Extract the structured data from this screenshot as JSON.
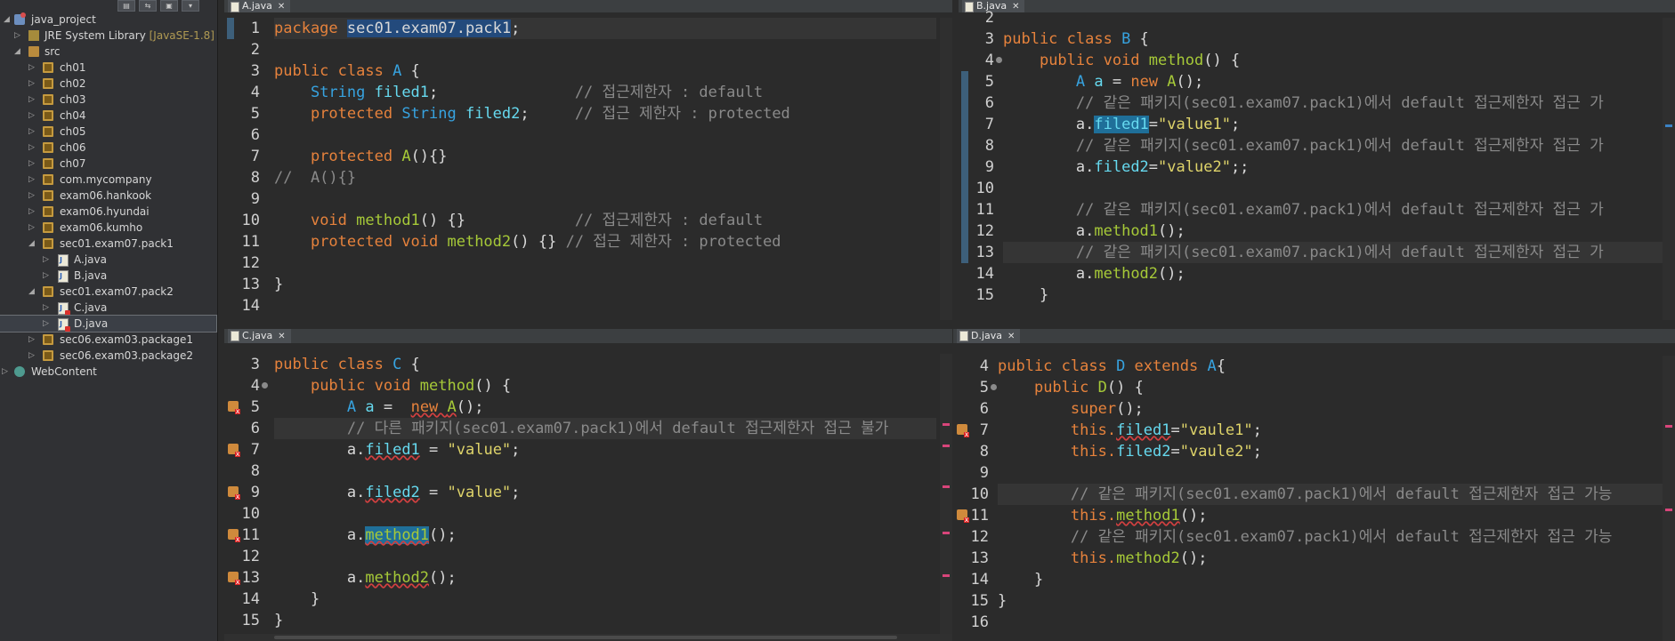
{
  "explorer": {
    "project": "java_project",
    "jre": {
      "name": "JRE System Library",
      "decorator": "[JavaSE-1.8]"
    },
    "src": "src",
    "packages": [
      "ch01",
      "ch02",
      "ch03",
      "ch04",
      "ch05",
      "ch06",
      "ch07",
      "com.mycompany",
      "exam06.hankook",
      "exam06.hyundai",
      "exam06.kumho"
    ],
    "pack1": {
      "name": "sec01.exam07.pack1",
      "files": [
        "A.java",
        "B.java"
      ]
    },
    "pack2": {
      "name": "sec01.exam07.pack2",
      "files": [
        "C.java",
        "D.java"
      ]
    },
    "more_packages": [
      "sec06.exam03.package1",
      "sec06.exam03.package2"
    ],
    "webcontent": "WebContent"
  },
  "editors": {
    "a": {
      "tab": "A.java",
      "lines": [
        "1",
        "2",
        "3",
        "4",
        "5",
        "6",
        "7",
        "8",
        "9",
        "10",
        "11",
        "12",
        "13",
        "14"
      ],
      "code": {
        "l1_kw": "package ",
        "l1_pkg": "sec01.exam07.pack1",
        "l1_end": ";",
        "l3_kw": "public class ",
        "l3_name": "A",
        "l3_end": " {",
        "l4_ty": "String ",
        "l4_f": "filed1",
        "l4_semi": ";",
        "l4_cm": "// 접근제한자 : default",
        "l5_kw": "protected ",
        "l5_ty": "String ",
        "l5_f": "filed2",
        "l5_semi": ";",
        "l5_cm": "// 접근 제한자 : protected",
        "l7_kw": "protected ",
        "l7_fn": "A",
        "l7_end": "(){}",
        "l8_cm": "//  A(){}",
        "l10_kw": "void ",
        "l10_fn": "method1",
        "l10_end": "() {}",
        "l10_cm": "// 접근제한자 : default",
        "l11_kw": "protected void ",
        "l11_fn": "method2",
        "l11_end": "() {}",
        "l11_cm": "// 접근 제한자 : protected",
        "l13": "}"
      }
    },
    "b": {
      "tab": "B.java",
      "lines": [
        "2",
        "3",
        "4",
        "5",
        "6",
        "7",
        "8",
        "9",
        "10",
        "11",
        "12",
        "13",
        "14",
        "15"
      ],
      "code": {
        "l3_kw": "public class ",
        "l3_name": "B",
        "l3_end": " {",
        "l4_kw": "public void ",
        "l4_fn": "method",
        "l4_end": "() {",
        "l5_ty": "A ",
        "l5_var": "a",
        "l5_eq": " = ",
        "l5_new": "new ",
        "l5_fn": "A",
        "l5_end": "();",
        "l6_cm": "// 같은 패키지(sec01.exam07.pack1)에서 default 접근제한자 접근 가",
        "l7_a": "a.",
        "l7_f": "filed1",
        "l7_eq": "=",
        "l7_s": "\"value1\"",
        "l7_end": ";",
        "l8_cm": "// 같은 패키지(sec01.exam07.pack1)에서 default 접근제한자 접근 가",
        "l9_a": "a.",
        "l9_f": "filed2",
        "l9_eq": "=",
        "l9_s": "\"value2\"",
        "l9_end": ";;",
        "l11_cm": "// 같은 패키지(sec01.exam07.pack1)에서 default 접근제한자 접근 가",
        "l12_a": "a.",
        "l12_fn": "method1",
        "l12_end": "();",
        "l13_cm": "// 같은 패키지(sec01.exam07.pack1)에서 default 접근제한자 접근 가",
        "l14_a": "a.",
        "l14_fn": "method2",
        "l14_end": "();",
        "l15": "}"
      }
    },
    "c": {
      "tab": "C.java",
      "lines": [
        "3",
        "4",
        "5",
        "6",
        "7",
        "8",
        "9",
        "10",
        "11",
        "12",
        "13",
        "14",
        "15"
      ],
      "code": {
        "l3_kw": "public class ",
        "l3_name": "C",
        "l3_end": " {",
        "l4_kw": "public void ",
        "l4_fn": "method",
        "l4_end": "() {",
        "l5_ty": "A ",
        "l5_var": "a",
        "l5_eq": " =  ",
        "l5_new": "new ",
        "l5_fn": "A",
        "l5_end": "();",
        "l6_cm": "// 다른 패키지(sec01.exam07.pack1)에서 default 접근제한자 접근 불가",
        "l7_a": "a.",
        "l7_f": "filed1",
        "l7_eq": " = ",
        "l7_s": "\"value\"",
        "l7_end": ";",
        "l9_a": "a.",
        "l9_f": "filed2",
        "l9_eq": " = ",
        "l9_s": "\"value\"",
        "l9_end": ";",
        "l11_a": "a.",
        "l11_fn": "method1",
        "l11_end": "();",
        "l13_a": "a.",
        "l13_fn": "method2",
        "l13_end": "();",
        "l14": "}",
        "l15": "}"
      }
    },
    "d": {
      "tab": "D.java",
      "lines": [
        "4",
        "5",
        "6",
        "7",
        "8",
        "9",
        "10",
        "11",
        "12",
        "13",
        "14",
        "15",
        "16"
      ],
      "code": {
        "l4_kw": "public class ",
        "l4_name": "D",
        "l4_ext": " extends ",
        "l4_sup": "A",
        "l4_end": "{",
        "l5_kw": "public ",
        "l5_fn": "D",
        "l5_end": "() {",
        "l6_kw": "super",
        "l6_end": "();",
        "l7_this": "this.",
        "l7_f": "filed1",
        "l7_eq": "=",
        "l7_s": "\"vaule1\"",
        "l7_end": ";",
        "l8_this": "this.",
        "l8_f": "filed2",
        "l8_eq": "=",
        "l8_s": "\"vaule2\"",
        "l8_end": ";",
        "l10_cm": "// 같은 패키지(sec01.exam07.pack1)에서 default 접근제한자 접근 가능",
        "l11_this": "this.",
        "l11_fn": "method1",
        "l11_end": "();",
        "l12_cm": "// 같은 패키지(sec01.exam07.pack1)에서 default 접근제한자 접근 가능",
        "l13_this": "this.",
        "l13_fn": "method2",
        "l13_end": "();",
        "l14": "}",
        "l15": "}"
      }
    }
  }
}
